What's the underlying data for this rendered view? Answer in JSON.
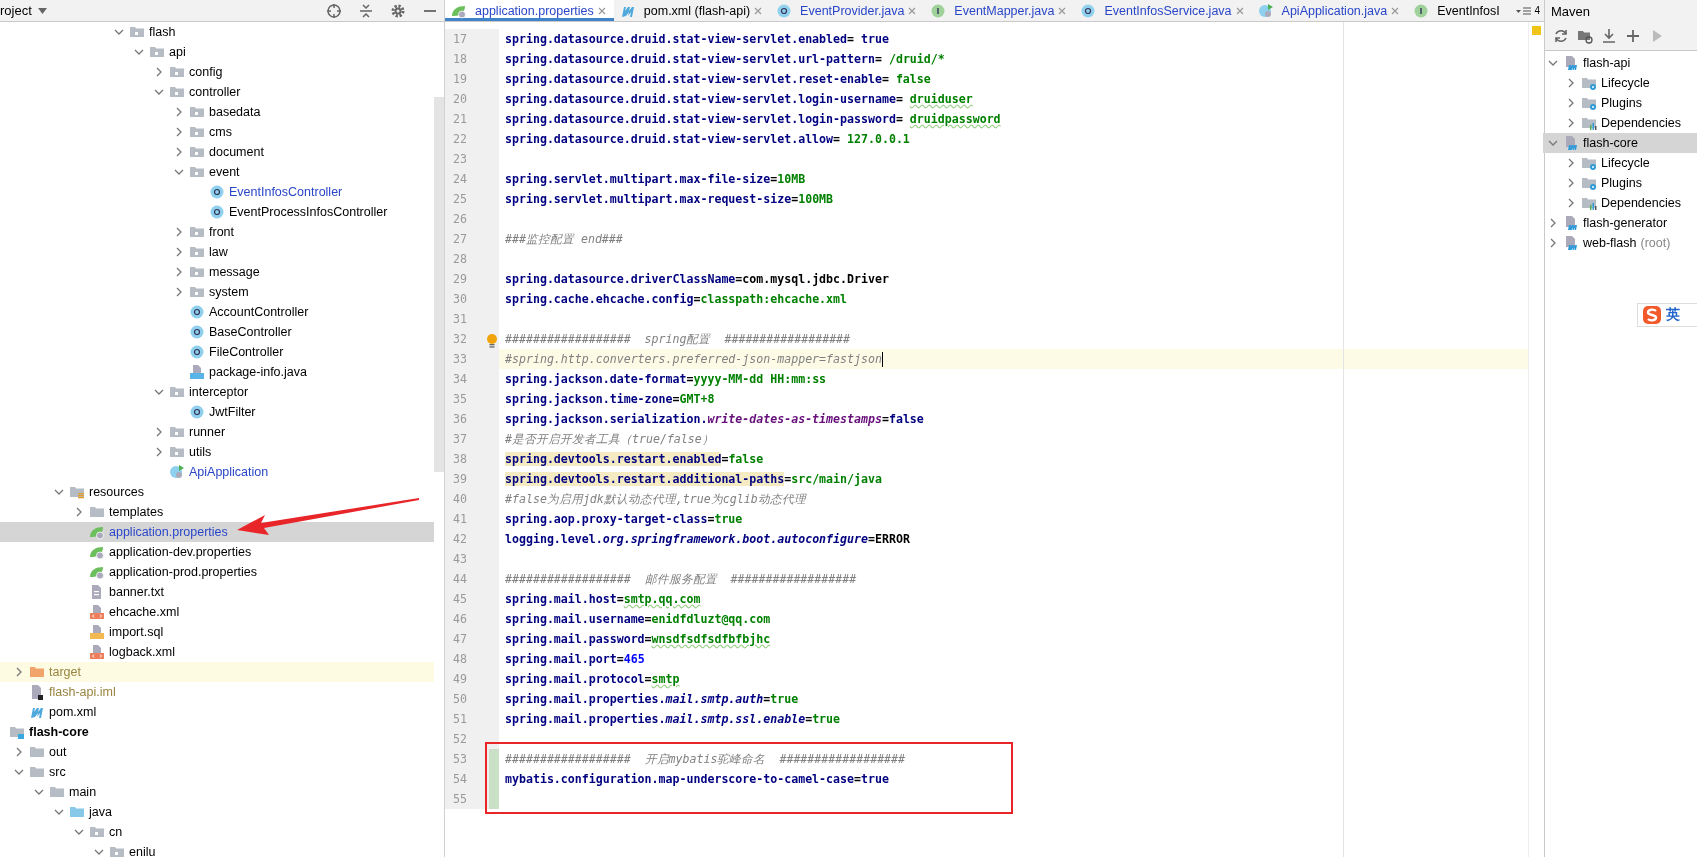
{
  "project_panel": {
    "title": "roject",
    "tree": [
      {
        "children": [
          {
            "children": [
              {
                "children": [
                  {
                    "children": [
                      {
                        "children": [
                          {
                            "children": [
                              {
                                "label": "flash",
                                "kind": "package",
                                "expanded": true,
                                "selected": false,
                                "children": [
                                  {
                                    "label": "api",
                                    "kind": "package",
                                    "expanded": true,
                                    "selected": false,
                                    "children": [
                                      {
                                        "label": "config",
                                        "kind": "package",
                                        "expanded": false,
                                        "selected": false
                                      },
                                      {
                                        "label": "controller",
                                        "kind": "package",
                                        "expanded": true,
                                        "selected": false,
                                        "children": [
                                          {
                                            "label": "basedata",
                                            "kind": "package",
                                            "expanded": false,
                                            "selected": false
                                          },
                                          {
                                            "label": "cms",
                                            "kind": "package",
                                            "expanded": false,
                                            "selected": false
                                          },
                                          {
                                            "label": "document",
                                            "kind": "package",
                                            "expanded": false,
                                            "selected": false
                                          },
                                          {
                                            "label": "event",
                                            "kind": "package",
                                            "expanded": true,
                                            "selected": false,
                                            "children": [
                                              {
                                                "label": "EventInfosController",
                                                "kind": "class",
                                                "modified": true,
                                                "selected": false
                                              },
                                              {
                                                "label": "EventProcessInfosController",
                                                "kind": "class",
                                                "selected": false
                                              }
                                            ]
                                          },
                                          {
                                            "label": "front",
                                            "kind": "package",
                                            "expanded": false,
                                            "selected": false
                                          },
                                          {
                                            "label": "law",
                                            "kind": "package",
                                            "expanded": false,
                                            "selected": false
                                          },
                                          {
                                            "label": "message",
                                            "kind": "package",
                                            "expanded": false,
                                            "selected": false
                                          },
                                          {
                                            "label": "system",
                                            "kind": "package",
                                            "expanded": false,
                                            "selected": false
                                          },
                                          {
                                            "label": "AccountController",
                                            "kind": "class",
                                            "selected": false
                                          },
                                          {
                                            "label": "BaseController",
                                            "kind": "class",
                                            "selected": false
                                          },
                                          {
                                            "label": "FileController",
                                            "kind": "class",
                                            "selected": false
                                          },
                                          {
                                            "label": "package-info.java",
                                            "kind": "java-file",
                                            "selected": false
                                          }
                                        ]
                                      },
                                      {
                                        "label": "interceptor",
                                        "kind": "package",
                                        "expanded": true,
                                        "selected": false,
                                        "children": [
                                          {
                                            "label": "JwtFilter",
                                            "kind": "class",
                                            "selected": false
                                          }
                                        ]
                                      },
                                      {
                                        "label": "runner",
                                        "kind": "package",
                                        "expanded": false,
                                        "selected": false
                                      },
                                      {
                                        "label": "utils",
                                        "kind": "package",
                                        "expanded": false,
                                        "selected": false
                                      },
                                      {
                                        "label": "ApiApplication",
                                        "kind": "spring-app",
                                        "modified": true,
                                        "selected": false
                                      }
                                    ]
                                  }
                                ]
                              }
                            ]
                          }
                        ]
                      }
                    ]
                  },
                  {
                    "label": "resources",
                    "kind": "resources-folder",
                    "expanded": true,
                    "selected": false,
                    "children": [
                      {
                        "label": "templates",
                        "kind": "folder",
                        "expanded": false,
                        "selected": false
                      },
                      {
                        "label": "application.properties",
                        "kind": "spring-props",
                        "modified": true,
                        "selected": true
                      },
                      {
                        "label": "application-dev.properties",
                        "kind": "spring-props",
                        "selected": false
                      },
                      {
                        "label": "application-prod.properties",
                        "kind": "spring-props",
                        "selected": false
                      },
                      {
                        "label": "banner.txt",
                        "kind": "text-file",
                        "selected": false
                      },
                      {
                        "label": "ehcache.xml",
                        "kind": "xml-file",
                        "selected": false
                      },
                      {
                        "label": "import.sql",
                        "kind": "sql-file",
                        "selected": false
                      },
                      {
                        "label": "logback.xml",
                        "kind": "xml-file",
                        "selected": false
                      }
                    ]
                  }
                ]
              }
            ]
          },
          {
            "label": "target",
            "kind": "excluded-folder",
            "excluded": true,
            "expanded": false,
            "selected": false
          },
          {
            "label": "flash-api.iml",
            "kind": "iml-file",
            "ignored": true,
            "selected": false
          },
          {
            "label": "pom.xml",
            "kind": "maven-file",
            "selected": false
          }
        ]
      },
      {
        "label": "flash-core",
        "kind": "module",
        "selected": false,
        "children": [
          {
            "label": "out",
            "kind": "folder",
            "expanded": false,
            "selected": false
          },
          {
            "label": "src",
            "kind": "folder",
            "expanded": true,
            "selected": false,
            "children": [
              {
                "label": "main",
                "kind": "folder",
                "expanded": true,
                "selected": false,
                "children": [
                  {
                    "label": "java",
                    "kind": "source-folder",
                    "expanded": true,
                    "selected": false,
                    "children": [
                      {
                        "label": "cn",
                        "kind": "package",
                        "expanded": true,
                        "selected": false,
                        "children": [
                          {
                            "label": "enilu",
                            "kind": "package",
                            "expanded": true,
                            "selected": false
                          }
                        ]
                      }
                    ]
                  }
                ]
              }
            ]
          }
        ]
      }
    ]
  },
  "editor": {
    "tabs": [
      {
        "label": "application.properties",
        "kind": "spring-props",
        "modified": true,
        "selected": true,
        "closable": true
      },
      {
        "label": "pom.xml (flash-api)",
        "kind": "maven-file",
        "modified": false,
        "selected": false,
        "closable": true
      },
      {
        "label": "EventProvider.java",
        "kind": "class",
        "modified": true,
        "selected": false,
        "closable": true
      },
      {
        "label": "EventMapper.java",
        "kind": "interface",
        "modified": true,
        "selected": false,
        "closable": true
      },
      {
        "label": "EventInfosService.java",
        "kind": "class",
        "modified": true,
        "selected": false,
        "closable": true
      },
      {
        "label": "ApiApplication.java",
        "kind": "spring-app",
        "modified": true,
        "selected": false,
        "closable": true
      },
      {
        "label": "EventInfosI",
        "kind": "interface",
        "modified": false,
        "selected": false,
        "closable": false
      }
    ],
    "hidden_tabs": "4",
    "lines": [
      {
        "num": "17",
        "tokens": [
          {
            "text": "spring.datasource.druid.stat-view-servlet.enabled",
            "kind": "key"
          },
          {
            "text": "= ",
            "kind": "sep"
          },
          {
            "text": "true",
            "kind": "key"
          }
        ]
      },
      {
        "num": "18",
        "tokens": [
          {
            "text": "spring.datasource.druid.stat-view-servlet.url-pattern",
            "kind": "key"
          },
          {
            "text": "= ",
            "kind": "sep"
          },
          {
            "text": "/druid/*",
            "kind": "value"
          }
        ]
      },
      {
        "num": "19",
        "tokens": [
          {
            "text": "spring.datasource.druid.stat-view-servlet.reset-enable",
            "kind": "key"
          },
          {
            "text": "= ",
            "kind": "sep"
          },
          {
            "text": "false",
            "kind": "value"
          }
        ]
      },
      {
        "num": "20",
        "tokens": [
          {
            "text": "spring.datasource.druid.stat-view-servlet.login-username",
            "kind": "key"
          },
          {
            "text": "= ",
            "kind": "sep"
          },
          {
            "text": "druiduser",
            "kind": "value",
            "typo": true
          }
        ]
      },
      {
        "num": "21",
        "tokens": [
          {
            "text": "spring.datasource.druid.stat-view-servlet.login-password",
            "kind": "key"
          },
          {
            "text": "= ",
            "kind": "sep"
          },
          {
            "text": "druidpassword",
            "kind": "value",
            "typo": true
          }
        ]
      },
      {
        "num": "22",
        "tokens": [
          {
            "text": "spring.datasource.druid.stat-view-servlet.allow",
            "kind": "key"
          },
          {
            "text": "= ",
            "kind": "sep"
          },
          {
            "text": "127.0.0.1",
            "kind": "value"
          }
        ]
      },
      {
        "num": "23"
      },
      {
        "num": "24",
        "tokens": [
          {
            "text": "spring.servlet.multipart.max-file-size",
            "kind": "key"
          },
          {
            "text": "=",
            "kind": "sep"
          },
          {
            "text": "10MB",
            "kind": "value"
          }
        ]
      },
      {
        "num": "25",
        "tokens": [
          {
            "text": "spring.servlet.multipart.max-request-size",
            "kind": "key"
          },
          {
            "text": "=",
            "kind": "sep"
          },
          {
            "text": "100MB",
            "kind": "value"
          }
        ]
      },
      {
        "num": "26"
      },
      {
        "num": "27",
        "tokens": [
          {
            "text": "###监控配置 end###",
            "kind": "comment"
          }
        ]
      },
      {
        "num": "28"
      },
      {
        "num": "29",
        "tokens": [
          {
            "text": "spring.datasource.driverClassName",
            "kind": "key"
          },
          {
            "text": "=",
            "kind": "sep"
          },
          {
            "text": "com.mysql.jdbc.Driver",
            "kind": "plain"
          }
        ]
      },
      {
        "num": "30",
        "tokens": [
          {
            "text": "spring.cache.ehcache.config",
            "kind": "key"
          },
          {
            "text": "=",
            "kind": "sep"
          },
          {
            "text": "classpath:ehcache.xml",
            "kind": "value"
          }
        ]
      },
      {
        "num": "31"
      },
      {
        "num": "32",
        "bulb": true,
        "tokens": [
          {
            "text": "##################  spring配置  ##################",
            "kind": "comment"
          }
        ]
      },
      {
        "num": "33",
        "current": true,
        "tokens": [
          {
            "text": "#spring.http.converters.preferred-json-mapper=fastjson",
            "kind": "comment"
          }
        ]
      },
      {
        "num": "34",
        "tokens": [
          {
            "text": "spring.jackson.date-format",
            "kind": "key"
          },
          {
            "text": "=",
            "kind": "sep"
          },
          {
            "text": "yyyy-MM-dd HH:mm:ss",
            "kind": "value"
          }
        ]
      },
      {
        "num": "35",
        "tokens": [
          {
            "text": "spring.jackson.time-zone",
            "kind": "key"
          },
          {
            "text": "=",
            "kind": "sep"
          },
          {
            "text": "GMT+8",
            "kind": "value"
          }
        ]
      },
      {
        "num": "36",
        "tokens": [
          {
            "text": "spring.jackson.serialization.",
            "kind": "key"
          },
          {
            "text": "write-dates-as-timestamps",
            "kind": "purple"
          },
          {
            "text": "=",
            "kind": "sep"
          },
          {
            "text": "false",
            "kind": "key"
          }
        ]
      },
      {
        "num": "37",
        "tokens": [
          {
            "text": "#是否开启开发者工具（true/false）",
            "kind": "comment"
          }
        ]
      },
      {
        "num": "38",
        "tokens": [
          {
            "text": "spring.devtools.restart.enabled",
            "kind": "key",
            "marked": true
          },
          {
            "text": "=",
            "kind": "sep"
          },
          {
            "text": "false",
            "kind": "value"
          }
        ]
      },
      {
        "num": "39",
        "tokens": [
          {
            "text": "spring.devtools.restart.additional-paths",
            "kind": "key",
            "marked": true
          },
          {
            "text": "=",
            "kind": "sep"
          },
          {
            "text": "src/main/java",
            "kind": "value"
          }
        ]
      },
      {
        "num": "40",
        "tokens": [
          {
            "text": "#false为启用jdk默认动态代理,true为cglib动态代理",
            "kind": "comment"
          }
        ]
      },
      {
        "num": "41",
        "tokens": [
          {
            "text": "spring.aop.proxy-target-class",
            "kind": "key"
          },
          {
            "text": "=",
            "kind": "sep"
          },
          {
            "text": "true",
            "kind": "value"
          }
        ]
      },
      {
        "num": "42",
        "tokens": [
          {
            "text": "logging.level.",
            "kind": "key"
          },
          {
            "text": "org.springframework.boot.autoconfigure",
            "kind": "ikey"
          },
          {
            "text": "=",
            "kind": "sep"
          },
          {
            "text": "ERROR",
            "kind": "plain"
          }
        ]
      },
      {
        "num": "43"
      },
      {
        "num": "44",
        "tokens": [
          {
            "text": "##################  邮件服务配置  ##################",
            "kind": "comment"
          }
        ]
      },
      {
        "num": "45",
        "tokens": [
          {
            "text": "spring.mail.host",
            "kind": "key"
          },
          {
            "text": "=",
            "kind": "sep"
          },
          {
            "text": "smtp.qq.com",
            "kind": "value",
            "typo": true
          }
        ]
      },
      {
        "num": "46",
        "tokens": [
          {
            "text": "spring.mail.username",
            "kind": "key"
          },
          {
            "text": "=",
            "kind": "sep"
          },
          {
            "text": "enidfdluzt@qq.com",
            "kind": "value"
          }
        ]
      },
      {
        "num": "47",
        "tokens": [
          {
            "text": "spring.mail.password",
            "kind": "key"
          },
          {
            "text": "=",
            "kind": "sep"
          },
          {
            "text": "wnsdfsdfsdfbfbjhc",
            "kind": "value",
            "typo": true
          }
        ]
      },
      {
        "num": "48",
        "tokens": [
          {
            "text": "spring.mail.port",
            "kind": "key"
          },
          {
            "text": "=",
            "kind": "sep"
          },
          {
            "text": "465",
            "kind": "number"
          }
        ]
      },
      {
        "num": "49",
        "tokens": [
          {
            "text": "spring.mail.protocol",
            "kind": "key"
          },
          {
            "text": "=",
            "kind": "sep"
          },
          {
            "text": "smtp",
            "kind": "value",
            "typo": true
          }
        ]
      },
      {
        "num": "50",
        "tokens": [
          {
            "text": "spring.mail.properties.",
            "kind": "key"
          },
          {
            "text": "mail.smtp.auth",
            "kind": "ikey"
          },
          {
            "text": "=",
            "kind": "sep"
          },
          {
            "text": "true",
            "kind": "value"
          }
        ]
      },
      {
        "num": "51",
        "tokens": [
          {
            "text": "spring.mail.properties.",
            "kind": "key"
          },
          {
            "text": "mail.smtp.ssl.enable",
            "kind": "ikey"
          },
          {
            "text": "=",
            "kind": "sep"
          },
          {
            "text": "true",
            "kind": "value"
          }
        ]
      },
      {
        "num": "52"
      },
      {
        "num": "53",
        "changed": true,
        "tokens": [
          {
            "text": "##################  开启mybatis驼峰命名  ##################",
            "kind": "comment"
          }
        ]
      },
      {
        "num": "54",
        "changed": true,
        "tokens": [
          {
            "text": "mybatis.configuration.map-underscore-to-camel-case",
            "kind": "key"
          },
          {
            "text": "=",
            "kind": "sep"
          },
          {
            "text": "true",
            "kind": "key"
          }
        ]
      },
      {
        "num": "55",
        "changed": true
      }
    ]
  },
  "maven_panel": {
    "title": "Maven",
    "tree": [
      {
        "label": "flash-api",
        "kind": "module",
        "expanded": true,
        "selected": false,
        "children": [
          {
            "label": "Lifecycle",
            "kind": "lifecycle",
            "expanded": false,
            "selected": false
          },
          {
            "label": "Plugins",
            "kind": "plugins",
            "expanded": false,
            "selected": false
          },
          {
            "label": "Dependencies",
            "kind": "dependencies",
            "expanded": false,
            "selected": false
          }
        ]
      },
      {
        "label": "flash-core",
        "kind": "module",
        "expanded": true,
        "selected": true,
        "children": [
          {
            "label": "Lifecycle",
            "kind": "lifecycle",
            "expanded": false,
            "selected": false
          },
          {
            "label": "Plugins",
            "kind": "plugins",
            "expanded": false,
            "selected": false
          },
          {
            "label": "Dependencies",
            "kind": "dependencies",
            "expanded": false,
            "selected": false
          }
        ]
      },
      {
        "label": "flash-generator",
        "kind": "module",
        "expanded": false,
        "selected": false
      },
      {
        "label": "web-flash",
        "suffix": "(root)",
        "kind": "module",
        "expanded": false,
        "selected": false
      }
    ]
  },
  "input_method": {
    "mode": "英"
  }
}
